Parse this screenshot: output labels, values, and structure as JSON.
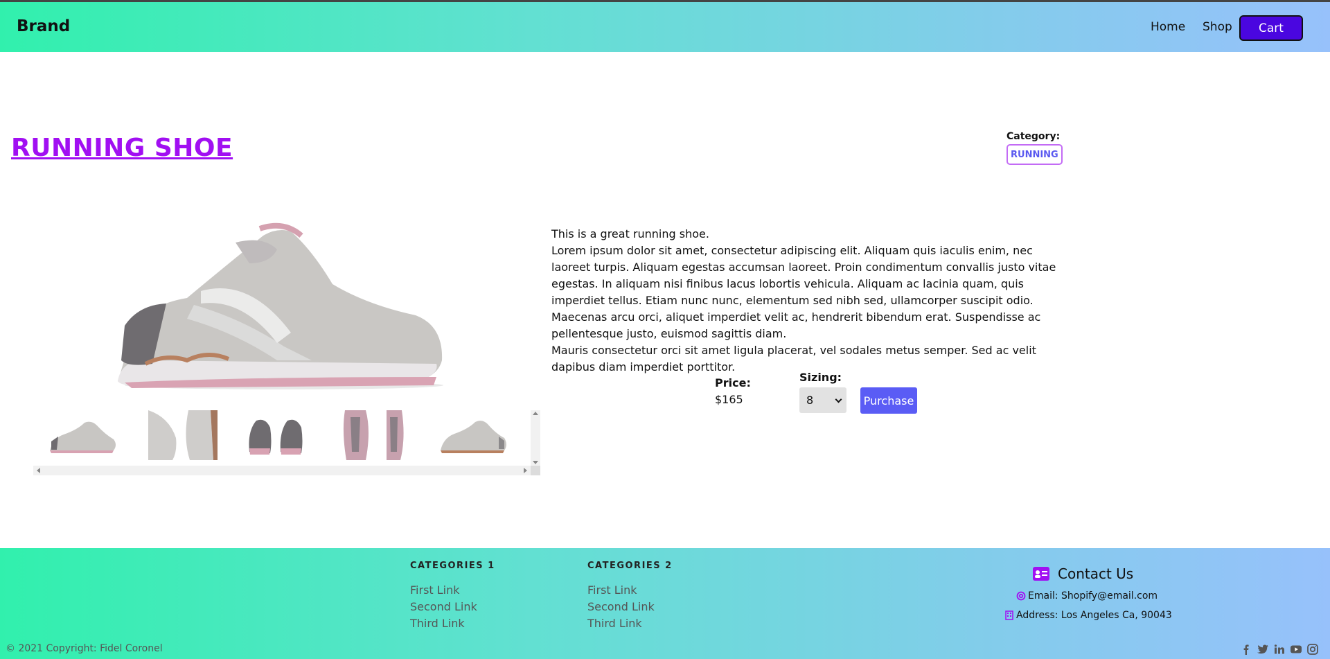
{
  "navbar": {
    "brand": "Brand",
    "links": [
      {
        "label": "Home"
      },
      {
        "label": "Shop"
      },
      {
        "label": "Cart"
      }
    ]
  },
  "product": {
    "title": "RUNNING SHOE",
    "category_label": "Category:",
    "category": "RUNNING",
    "description": [
      "This is a great running shoe.",
      "Lorem ipsum dolor sit amet, consectetur adipiscing elit. Aliquam quis iaculis enim, nec laoreet turpis. Aliquam egestas accumsan laoreet. Proin condimentum convallis justo vitae egestas. In aliquam nisi finibus lacus lobortis vehicula. Aliquam ac lacinia quam, quis imperdiet tellus. Etiam nunc nunc, elementum sed nibh sed, ullamcorper suscipit odio. Maecenas arcu orci, aliquet imperdiet velit ac, hendrerit bibendum erat. Suspendisse ac pellentesque justo, euismod sagittis diam.",
      "Mauris consectetur orci sit amet ligula placerat, vel sodales metus semper. Sed ac velit dapibus diam imperdiet porttitor."
    ],
    "price_label": "Price:",
    "price": "$165",
    "sizing_label": "Sizing:",
    "size_selected": "8",
    "purchase_label": "Purchase"
  },
  "footer": {
    "categories": [
      {
        "title": "CATEGORIES 1",
        "links": [
          "First Link",
          "Second Link",
          "Third Link"
        ]
      },
      {
        "title": "CATEGORIES 2",
        "links": [
          "First Link",
          "Second Link",
          "Third Link"
        ]
      }
    ],
    "contact_title": "Contact Us",
    "email": "Email: Shopify@email.com",
    "address": "Address: Los Angeles Ca, 90043",
    "copyright": "© 2021 Copyright: Fidel Coronel"
  },
  "colors": {
    "accent_purple": "#a10ff2",
    "cart_button": "#4a06e0",
    "purchase_button": "#5a5cf5"
  }
}
